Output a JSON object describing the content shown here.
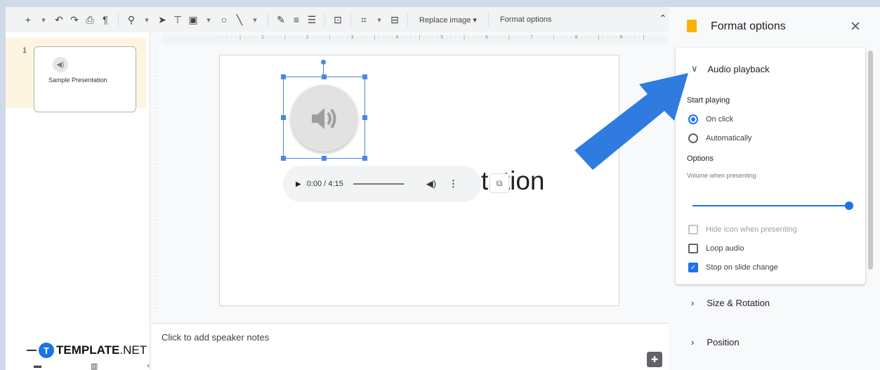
{
  "toolbar": {
    "icons": [
      "plus-icon",
      "dropdown-icon",
      "undo-icon",
      "redo-icon",
      "print-icon",
      "paint-format-icon",
      "zoom-icon",
      "select-icon",
      "textbox-icon",
      "image-icon",
      "shape-icon",
      "line-icon",
      "pen-icon",
      "border-weight-icon",
      "border-dash-icon",
      "alt-text-icon",
      "crop-icon",
      "mask-icon"
    ],
    "replace_image": "Replace image",
    "format_options": "Format options"
  },
  "filmstrip": {
    "slide_number": "1",
    "slide_label": "Sample Presentation"
  },
  "ruler": {
    "marks": "· · · · | · · · · 1 · · · · | · · · · 2 · · · · | · · · · 3 · · · · | · · · · 4 · · · · | · · · · 5 · · · · | · · · · 6 · · · · | · · · · 7 · · · · | · · · · 8 · · · · | · · · · 9 · · · · |"
  },
  "slide": {
    "title_fragment": "tation",
    "player": {
      "time": "0:00 / 4:15"
    }
  },
  "notes": {
    "placeholder": "Click to add speaker notes"
  },
  "watermark": {
    "logo_letter": "T",
    "brand": "TEMPLATE",
    "suffix": ".NET"
  },
  "panel": {
    "title": "Format options",
    "audio_playback": {
      "heading": "Audio playback",
      "start_playing_label": "Start playing",
      "on_click": "On click",
      "automatically": "Automatically",
      "selected": "On click",
      "options_label": "Options",
      "volume_label": "Volume when presenting",
      "volume_level": 1.0,
      "hide_icon": "Hide icon when presenting",
      "hide_icon_checked": false,
      "loop_audio": "Loop audio",
      "loop_audio_checked": false,
      "stop_on_slide_change": "Stop on slide change",
      "stop_checked": true
    },
    "size_rotation": "Size & Rotation",
    "position": "Position"
  },
  "colors": {
    "accent": "#1a73e8",
    "arrow": "#2f7be0",
    "panel_icon": "#f4b400"
  }
}
